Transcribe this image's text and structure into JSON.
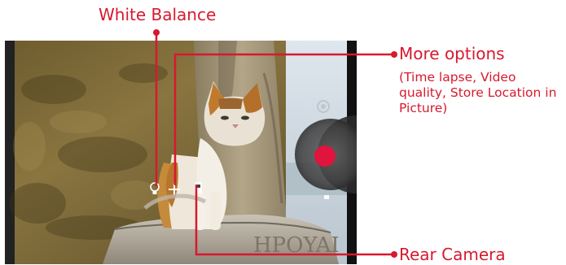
{
  "callouts": {
    "white_balance": {
      "label": "White Balance",
      "color": "#d7192d"
    },
    "more_options": {
      "label": "More options",
      "description": "(Time lapse, Video quality, Store Location in Picture)",
      "color": "#d7192d"
    },
    "rear_camera": {
      "label": "Rear Camera",
      "color": "#d7192d"
    }
  },
  "viewfinder": {
    "engraving": "HPOYAI"
  },
  "controls": {
    "white_balance_icon": "bulb-icon",
    "more_options_icon": "plus-icon",
    "rear_camera_icon": "camera-switch-icon",
    "gallery_icon": "camera-lens-icon",
    "shutter_icon": "record-icon",
    "shutter_color": "#e0143c"
  }
}
